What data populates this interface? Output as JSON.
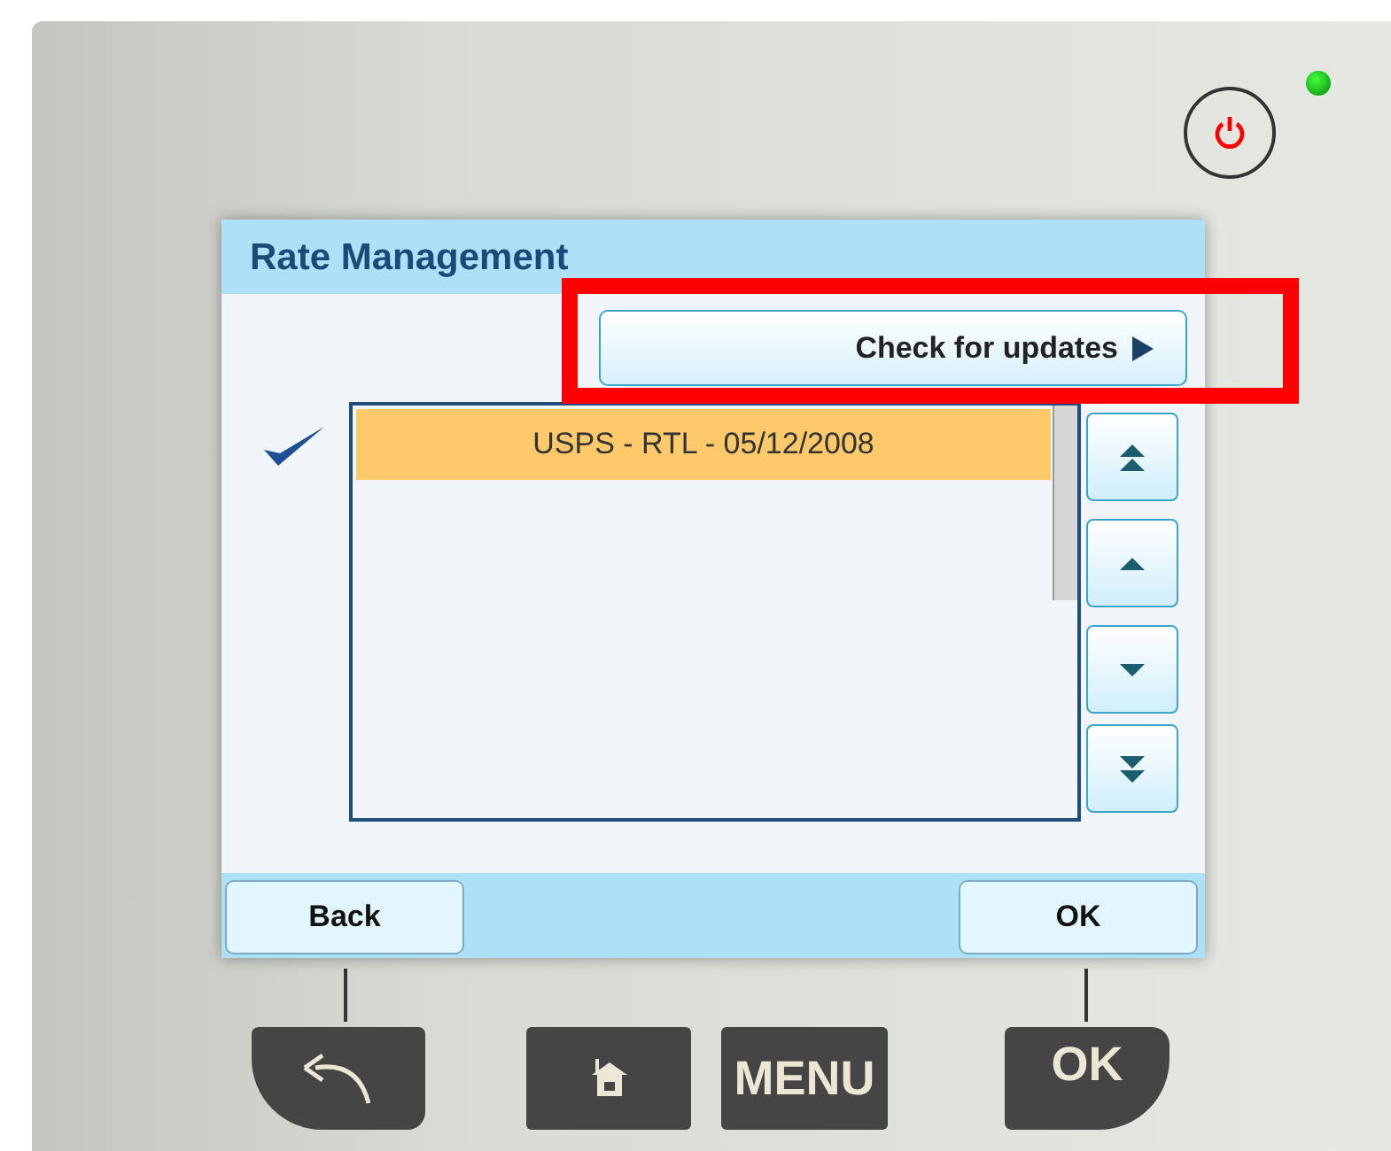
{
  "screen": {
    "title": "Rate Management",
    "action_button": {
      "label": "Check for updates"
    },
    "rates": [
      {
        "label": "USPS - RTL - 05/12/2008",
        "selected": true,
        "checked": true
      }
    ],
    "scroll_buttons": [
      {
        "kind": "top"
      },
      {
        "kind": "up"
      },
      {
        "kind": "down"
      },
      {
        "kind": "bottom"
      }
    ],
    "softkeys": [
      {
        "label": "Back"
      },
      {
        "label": "OK"
      }
    ]
  },
  "hardware_keys": [
    {
      "kind": "back"
    },
    {
      "kind": "home"
    },
    {
      "kind": "text",
      "label": "MENU"
    },
    {
      "kind": "text",
      "label": "OK"
    }
  ]
}
